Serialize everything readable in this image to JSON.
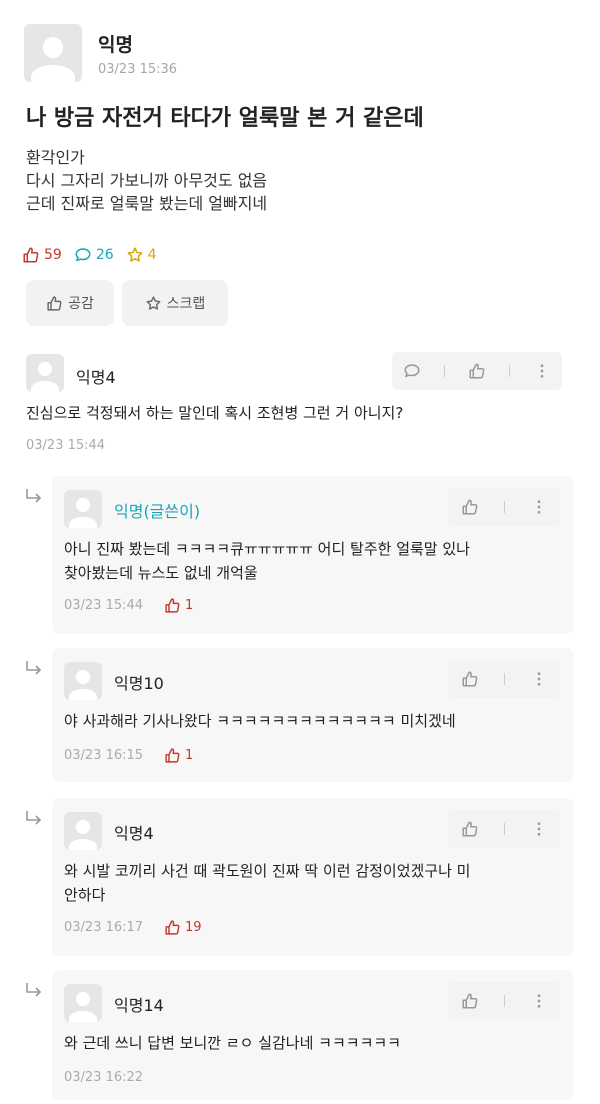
{
  "post": {
    "author": "익명",
    "date": "03/23 15:36",
    "title": "나 방금 자전거 타다가 얼룩말 본 거 같은데",
    "body": [
      "환각인가",
      "다시 그자리 가보니까 아무것도 없음",
      "근데 진짜로 얼룩말 봤는데 얼빠지네"
    ],
    "likes": "59",
    "comments": "26",
    "scraps": "4",
    "empathy_label": "공감",
    "scrap_label": "스크랩"
  },
  "colors": {
    "like": "#c0392b",
    "comment": "#1aa6b7",
    "scrap": "#d9a400",
    "op_author": "#1aa6b7"
  },
  "comments": [
    {
      "author": "익명4",
      "text": [
        "진심으로 걱정돼서 하는 말인데 혹시 조현병 그런 거 아니지?"
      ],
      "date": "03/23 15:44"
    }
  ],
  "replies": [
    {
      "author": "익명(글쓴이)",
      "text": [
        "아니 진짜 봤는데 ㅋㅋㅋㅋ큐ㅠㅠㅠㅠㅠ 어디 탈주한 얼룩말 있나",
        "찾아봤는데 뉴스도 없네 개억울"
      ],
      "date": "03/23 15:44",
      "likes": "1"
    },
    {
      "author": "익명10",
      "text": [
        "야 사과해라 기사나왔다 ㅋㅋㅋㅋㅋㅋㅋㅋㅋㅋㅋㅋㅋ 미치겠네"
      ],
      "date": "03/23 16:15",
      "likes": "1"
    },
    {
      "author": "익명4",
      "text": [
        "와 시발 코끼리 사건 때 곽도원이 진짜 딱 이런 감정이었겠구나 미",
        "안하다"
      ],
      "date": "03/23 16:17",
      "likes": "19"
    },
    {
      "author": "익명14",
      "text": [
        "와 근데 쓰니 답변 보니깐 ㄹㅇ 실감나네 ㅋㅋㅋㅋㅋㅋ"
      ],
      "date": "03/23 16:22",
      "likes": ""
    }
  ],
  "icons": [
    "thumbs-up-icon",
    "speech-bubble-icon",
    "star-icon",
    "more-vertical-icon",
    "reply-arrow-icon",
    "avatar-placeholder-icon"
  ]
}
